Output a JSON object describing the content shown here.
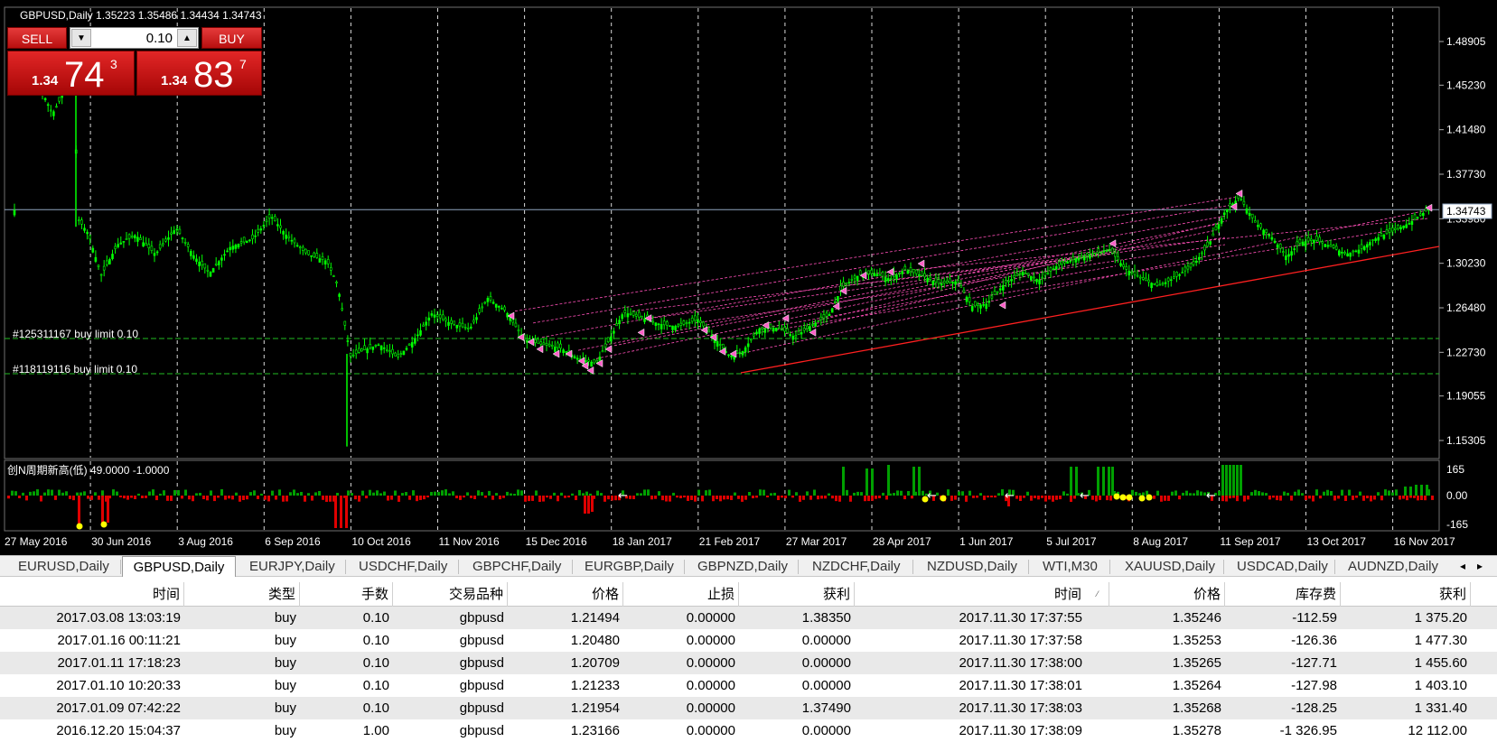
{
  "chart": {
    "header": "GBPUSD,Daily  1.35223 1.35486 1.34434 1.34743",
    "price_labels": [
      "1.48905",
      "1.45230",
      "1.41480",
      "1.37730",
      "1.33980",
      "1.30230",
      "1.26480",
      "1.22730",
      "1.19055",
      "1.15305"
    ],
    "current_price": "1.34743",
    "date_labels": [
      "27 May 2016",
      "30 Jun 2016",
      "3 Aug 2016",
      "6 Sep 2016",
      "10 Oct 2016",
      "11 Nov 2016",
      "15 Dec 2016",
      "18 Jan 2017",
      "21 Feb 2017",
      "27 Mar 2017",
      "28 Apr 2017",
      "1 Jun 2017",
      "5 Jul 2017",
      "8 Aug 2017",
      "11 Sep 2017",
      "13 Oct 2017",
      "16 Nov 2017"
    ],
    "orders": [
      "#125311167 buy limit 0.10",
      "#118119116 buy limit 0.10"
    ],
    "indicator_label": "创N周期新高(低) 49.0000 -1.0000",
    "indicator_levels": [
      "165",
      "0.00",
      "-165"
    ],
    "colors": {
      "up_candle": "#00ff00",
      "price_line": "#8fa5c0",
      "order_line": "#22bb22",
      "trendline": "#ff2020",
      "arrows": "#ff40c0",
      "hist_up": "#00a000",
      "hist_down": "#e00000",
      "dot": "#ffff00"
    }
  },
  "trade_panel": {
    "sell_label": "SELL",
    "buy_label": "BUY",
    "lot": "0.10",
    "sell_price": {
      "small": "1.34",
      "big": "74",
      "sup": "3"
    },
    "buy_price": {
      "small": "1.34",
      "big": "83",
      "sup": "7"
    }
  },
  "tabs": [
    "EURUSD,Daily",
    "GBPUSD,Daily",
    "EURJPY,Daily",
    "USDCHF,Daily",
    "GBPCHF,Daily",
    "EURGBP,Daily",
    "GBPNZD,Daily",
    "NZDCHF,Daily",
    "NZDUSD,Daily",
    "WTI,M30",
    "XAUUSD,Daily",
    "USDCAD,Daily",
    "AUDNZD,Daily"
  ],
  "active_tab": "GBPUSD,Daily",
  "table": {
    "headers": [
      "时间",
      "类型",
      "手数",
      "交易品种",
      "价格",
      "止损",
      "获利",
      "时间",
      "价格",
      "库存费",
      "获利"
    ],
    "rows": [
      [
        "2017.03.08 13:03:19",
        "buy",
        "0.10",
        "gbpusd",
        "1.21494",
        "0.00000",
        "1.38350",
        "2017.11.30 17:37:55",
        "1.35246",
        "-112.59",
        "1 375.20"
      ],
      [
        "2017.01.16 00:11:21",
        "buy",
        "0.10",
        "gbpusd",
        "1.20480",
        "0.00000",
        "0.00000",
        "2017.11.30 17:37:58",
        "1.35253",
        "-126.36",
        "1 477.30"
      ],
      [
        "2017.01.11 17:18:23",
        "buy",
        "0.10",
        "gbpusd",
        "1.20709",
        "0.00000",
        "0.00000",
        "2017.11.30 17:38:00",
        "1.35265",
        "-127.71",
        "1 455.60"
      ],
      [
        "2017.01.10 10:20:33",
        "buy",
        "0.10",
        "gbpusd",
        "1.21233",
        "0.00000",
        "0.00000",
        "2017.11.30 17:38:01",
        "1.35264",
        "-127.98",
        "1 403.10"
      ],
      [
        "2017.01.09 07:42:22",
        "buy",
        "0.10",
        "gbpusd",
        "1.21954",
        "0.00000",
        "1.37490",
        "2017.11.30 17:38:03",
        "1.35268",
        "-128.25",
        "1 331.40"
      ],
      [
        "2016.12.20 15:04:37",
        "buy",
        "1.00",
        "gbpusd",
        "1.23166",
        "0.00000",
        "0.00000",
        "2017.11.30 17:38:09",
        "1.35278",
        "-1 326.95",
        "12 112.00"
      ]
    ]
  }
}
